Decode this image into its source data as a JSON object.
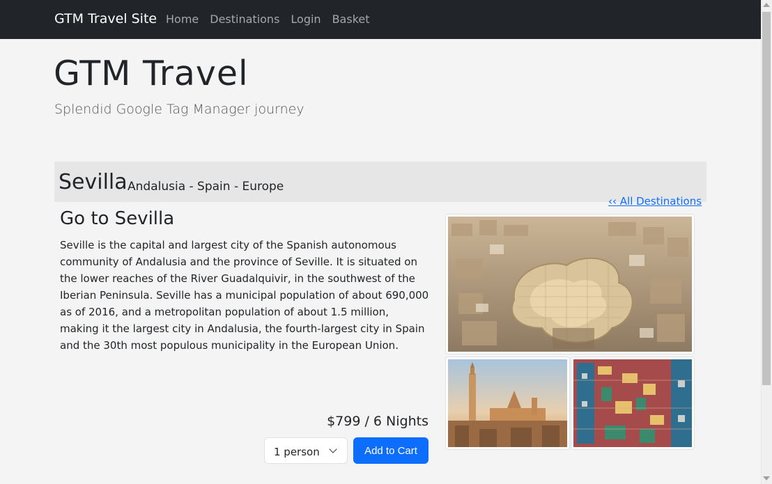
{
  "navbar": {
    "brand": "GTM Travel Site",
    "links": [
      "Home",
      "Destinations",
      "Login",
      "Basket"
    ]
  },
  "header": {
    "title": "GTM Travel",
    "subtitle": "Splendid Google Tag Manager journey"
  },
  "destination": {
    "city": "Sevilla",
    "region": "Andalusia - Spain - Europe",
    "all_link": "‹‹ All Destinations",
    "heading": "Go to Sevilla",
    "description": "Seville is the capital and largest city of the Spanish autonomous community of Andalusia and the province of Seville. It is situated on the lower reaches of the River Guadalquivir, in the southwest of the Iberian Peninsula. Seville has a municipal population of about 690,000 as of 2016, and a metropolitan population of about 1.5 million, making it the largest city in Andalusia, the fourth-largest city in Spain and the 30th most populous municipality in the European Union.",
    "price": "$799 / 6 Nights",
    "persons_selected": "1 person",
    "add_to_cart": "Add to Cart"
  },
  "colors": {
    "navbar_bg": "#212529",
    "accent": "#0d6efd",
    "page_bg": "#f4f4f4"
  }
}
